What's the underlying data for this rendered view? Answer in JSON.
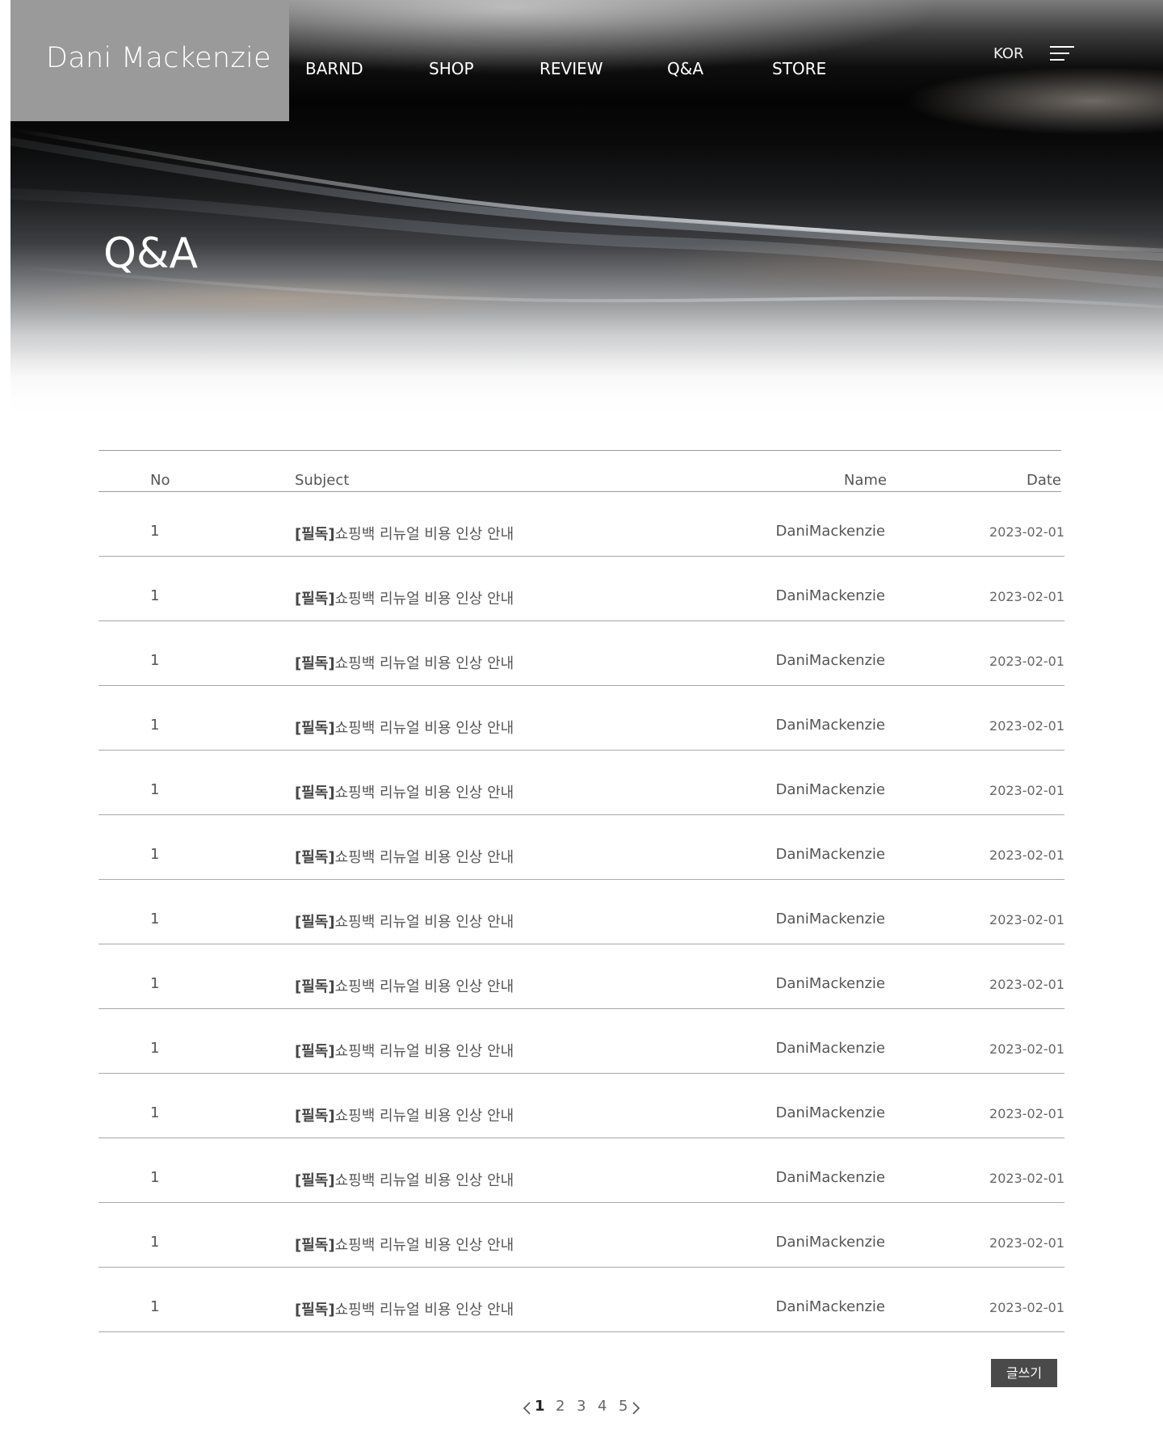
{
  "header": {
    "brand": "Dani Mackenzie",
    "nav": [
      "BARND",
      "SHOP",
      "REVIEW",
      "Q&A",
      "STORE"
    ],
    "lang": "KOR",
    "menu_icon": "hamburger-menu-icon"
  },
  "hero": {
    "title": "Q&A"
  },
  "table": {
    "columns": {
      "no": "No",
      "subject": "Subject",
      "name": "Name",
      "date": "Date"
    },
    "rows": [
      {
        "no": "1",
        "tag": "[필독]",
        "subject": "쇼핑백 리뉴얼 비용 인상 안내",
        "name": "DaniMackenzie",
        "date": "2023-02-01"
      },
      {
        "no": "1",
        "tag": "[필독]",
        "subject": "쇼핑백 리뉴얼 비용 인상 안내",
        "name": "DaniMackenzie",
        "date": "2023-02-01"
      },
      {
        "no": "1",
        "tag": "[필독]",
        "subject": "쇼핑백 리뉴얼 비용 인상 안내",
        "name": "DaniMackenzie",
        "date": "2023-02-01"
      },
      {
        "no": "1",
        "tag": "[필독]",
        "subject": "쇼핑백 리뉴얼 비용 인상 안내",
        "name": "DaniMackenzie",
        "date": "2023-02-01"
      },
      {
        "no": "1",
        "tag": "[필독]",
        "subject": "쇼핑백 리뉴얼 비용 인상 안내",
        "name": "DaniMackenzie",
        "date": "2023-02-01"
      },
      {
        "no": "1",
        "tag": "[필독]",
        "subject": "쇼핑백 리뉴얼 비용 인상 안내",
        "name": "DaniMackenzie",
        "date": "2023-02-01"
      },
      {
        "no": "1",
        "tag": "[필독]",
        "subject": "쇼핑백 리뉴얼 비용 인상 안내",
        "name": "DaniMackenzie",
        "date": "2023-02-01"
      },
      {
        "no": "1",
        "tag": "[필독]",
        "subject": "쇼핑백 리뉴얼 비용 인상 안내",
        "name": "DaniMackenzie",
        "date": "2023-02-01"
      },
      {
        "no": "1",
        "tag": "[필독]",
        "subject": "쇼핑백 리뉴얼 비용 인상 안내",
        "name": "DaniMackenzie",
        "date": "2023-02-01"
      },
      {
        "no": "1",
        "tag": "[필독]",
        "subject": "쇼핑백 리뉴얼 비용 인상 안내",
        "name": "DaniMackenzie",
        "date": "2023-02-01"
      },
      {
        "no": "1",
        "tag": "[필독]",
        "subject": "쇼핑백 리뉴얼 비용 인상 안내",
        "name": "DaniMackenzie",
        "date": "2023-02-01"
      },
      {
        "no": "1",
        "tag": "[필독]",
        "subject": "쇼핑백 리뉴얼 비용 인상 안내",
        "name": "DaniMackenzie",
        "date": "2023-02-01"
      },
      {
        "no": "1",
        "tag": "[필독]",
        "subject": "쇼핑백 리뉴얼 비용 인상 안내",
        "name": "DaniMackenzie",
        "date": "2023-02-01"
      }
    ]
  },
  "write_button": "글쓰기",
  "pagination": {
    "pages": [
      "1",
      "2",
      "3",
      "4",
      "5"
    ],
    "current": "1",
    "prev_icon": "chevron-left-icon",
    "next_icon": "chevron-right-icon"
  }
}
